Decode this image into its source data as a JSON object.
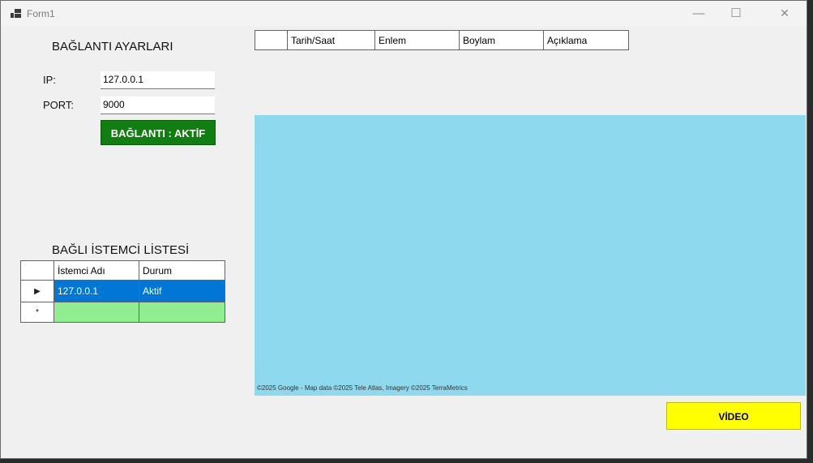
{
  "window": {
    "title": "Form1",
    "minimize_icon": "—",
    "maximize_icon": "☐",
    "close_icon": "✕"
  },
  "connection": {
    "heading": "BAĞLANTI AYARLARI",
    "ip_label": "IP:",
    "ip_value": "127.0.0.1",
    "port_label": "PORT:",
    "port_value": "9000",
    "status_button": "BAĞLANTI : AKTİF",
    "status_color": "#117e11"
  },
  "log_table": {
    "columns": [
      "",
      "Tarih/Saat",
      "Enlem",
      "Boylam",
      "Açıklama"
    ]
  },
  "clients": {
    "heading": "BAĞLI İSTEMCİ LİSTESİ",
    "columns": [
      "",
      "İstemci Adı",
      "Durum"
    ],
    "rows": [
      {
        "marker": "▶",
        "name": "127.0.0.1",
        "status": "Aktif"
      }
    ],
    "new_row_marker": "*",
    "selection_color": "#0077d7",
    "new_row_color": "#90ee90"
  },
  "map": {
    "attribution": "©2025 Google - Map data ©2025 Tele Atlas, Imagery ©2025 TerraMetrics",
    "water_color": "#8fd9ee"
  },
  "video_button": {
    "label": "VİDEO",
    "color": "#ffff00"
  }
}
